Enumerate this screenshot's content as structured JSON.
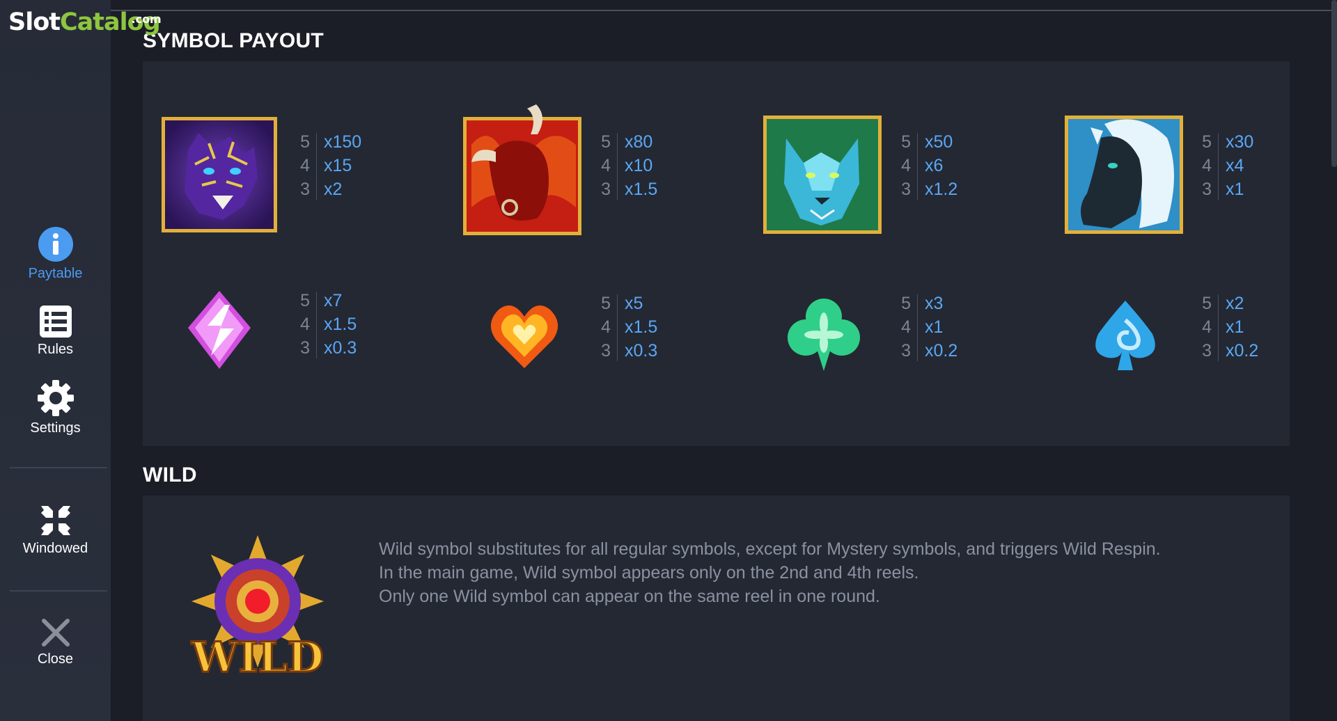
{
  "logo": {
    "slot": "Slot",
    "catalog": "Catalog",
    "com": ".com"
  },
  "sidebar": {
    "items": [
      {
        "label": "Paytable",
        "icon": "info-icon",
        "active": true
      },
      {
        "label": "Rules",
        "icon": "list-icon",
        "active": false
      },
      {
        "label": "Settings",
        "icon": "gear-icon",
        "active": false
      },
      {
        "label": "Windowed",
        "icon": "collapse-icon",
        "active": false
      },
      {
        "label": "Close",
        "icon": "close-icon",
        "active": false
      }
    ]
  },
  "symbol_payout": {
    "title": "SYMBOL PAYOUT",
    "symbols": [
      {
        "name": "tiger",
        "counts": [
          "5",
          "4",
          "3"
        ],
        "payouts": [
          "x150",
          "x15",
          "x2"
        ]
      },
      {
        "name": "bull",
        "counts": [
          "5",
          "4",
          "3"
        ],
        "payouts": [
          "x80",
          "x10",
          "x1.5"
        ]
      },
      {
        "name": "wolf",
        "counts": [
          "5",
          "4",
          "3"
        ],
        "payouts": [
          "x50",
          "x6",
          "x1.2"
        ]
      },
      {
        "name": "horse",
        "counts": [
          "5",
          "4",
          "3"
        ],
        "payouts": [
          "x30",
          "x4",
          "x1"
        ]
      },
      {
        "name": "lightning",
        "counts": [
          "5",
          "4",
          "3"
        ],
        "payouts": [
          "x7",
          "x1.5",
          "x0.3"
        ]
      },
      {
        "name": "heart",
        "counts": [
          "5",
          "4",
          "3"
        ],
        "payouts": [
          "x5",
          "x1.5",
          "x0.3"
        ]
      },
      {
        "name": "club",
        "counts": [
          "5",
          "4",
          "3"
        ],
        "payouts": [
          "x3",
          "x1",
          "x0.2"
        ]
      },
      {
        "name": "spade",
        "counts": [
          "5",
          "4",
          "3"
        ],
        "payouts": [
          "x2",
          "x1",
          "x0.2"
        ]
      }
    ]
  },
  "wild": {
    "title": "WILD",
    "badge_text": "WILD",
    "lines": [
      "Wild symbol substitutes for all regular symbols, except for Mystery symbols, and triggers Wild Respin.",
      "In the main game, Wild symbol appears only on the 2nd and 4th reels.",
      "Only one Wild symbol can appear on the same reel in one  round."
    ]
  },
  "colors": {
    "background": "#1b1e27",
    "panel": "#242833",
    "sidebar": "#282d39",
    "accent_blue": "#4b9bf0",
    "payout_value": "#5aa7f5",
    "muted_text": "#8a91a0",
    "logo_green": "#8ec63f"
  }
}
